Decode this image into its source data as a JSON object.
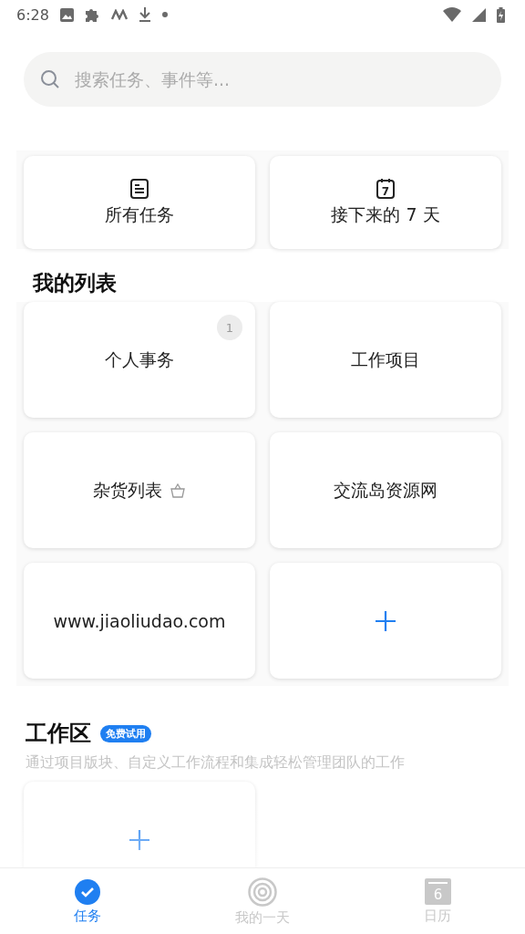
{
  "status_bar": {
    "time": "6:28"
  },
  "search": {
    "placeholder": "搜索任务、事件等..."
  },
  "smart_lists": [
    {
      "kind": "all",
      "label": "所有任务"
    },
    {
      "kind": "week",
      "label": "接下来的 7 天",
      "icon_digit": "7"
    }
  ],
  "my_lists": {
    "title": "我的列表",
    "items": [
      {
        "kind": "list",
        "label": "个人事务",
        "count": "1"
      },
      {
        "kind": "list",
        "label": "工作项目"
      },
      {
        "kind": "grocery",
        "label": "杂货列表"
      },
      {
        "kind": "list",
        "label": "交流岛资源网"
      },
      {
        "kind": "list",
        "label": "www.jiaoliudao.com"
      },
      {
        "kind": "add"
      }
    ]
  },
  "workspace": {
    "title": "工作区",
    "badge": "免费试用",
    "subtitle": "通过项目版块、自定义工作流程和集成轻松管理团队的工作",
    "items": [
      {
        "kind": "add"
      }
    ]
  },
  "tabs": [
    {
      "kind": "tasks",
      "label": "任务",
      "selected": true
    },
    {
      "kind": "today",
      "label": "我的一天",
      "selected": false
    },
    {
      "kind": "calendar",
      "label": "日历",
      "selected": false,
      "icon_digit": "6"
    }
  ]
}
